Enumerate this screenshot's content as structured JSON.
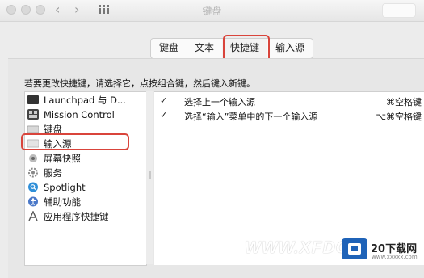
{
  "window": {
    "title": "键盘",
    "nav_back": "‹",
    "nav_forward": "›"
  },
  "tabs": [
    {
      "label": "键盘"
    },
    {
      "label": "文本"
    },
    {
      "label": "快捷键",
      "selected": true
    },
    {
      "label": "输入源"
    }
  ],
  "instruction": "若要更改快捷键，请选择它，点按组合键，然后键入新键。",
  "categories": [
    {
      "label": "Launchpad 与 D...",
      "icon": "launchpad-icon"
    },
    {
      "label": "Mission Control",
      "icon": "mission-control-icon"
    },
    {
      "label": "键盘",
      "icon": "keyboard-icon"
    },
    {
      "label": "输入源",
      "icon": "input-source-icon",
      "highlighted": true
    },
    {
      "label": "屏幕快照",
      "icon": "screenshot-icon"
    },
    {
      "label": "服务",
      "icon": "services-gear-icon"
    },
    {
      "label": "Spotlight",
      "icon": "spotlight-icon"
    },
    {
      "label": "辅助功能",
      "icon": "accessibility-icon"
    },
    {
      "label": "应用程序快捷键",
      "icon": "app-shortcuts-icon"
    }
  ],
  "shortcuts": [
    {
      "checked": "✓",
      "label": "选择上一个输入源",
      "key": "⌘空格键"
    },
    {
      "checked": "✓",
      "label": "选择“输入”菜单中的下一个输入源",
      "key": "⌥⌘空格键"
    }
  ],
  "watermark": {
    "text": "WWW.XFDO",
    "brand": "20下载网",
    "url": "www.xxxxx.com"
  },
  "colors": {
    "highlight_box": "#d9443b",
    "window_bg": "#ececec",
    "list_bg": "#ffffff"
  }
}
